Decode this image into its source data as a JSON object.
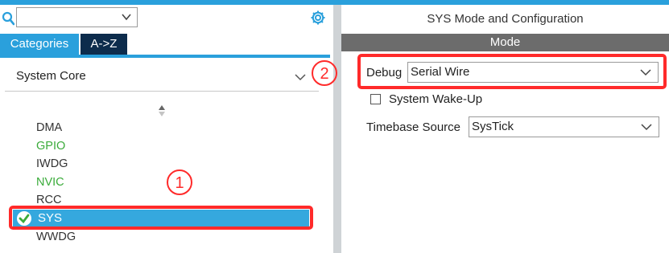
{
  "colors": {
    "accent": "#2aa0dc",
    "tab_dark": "#0d2c4c",
    "enabled_green": "#3aab3a",
    "selected_row": "#35a8de",
    "annotation_red": "#ff2a2a",
    "mode_bar": "#6c6c6c"
  },
  "left": {
    "search": {
      "value": "",
      "icon": "search-icon"
    },
    "tabs": [
      {
        "label": "Categories",
        "active": true
      },
      {
        "label": "A->Z",
        "active": false
      }
    ],
    "category": {
      "title": "System Core"
    },
    "items": [
      {
        "label": "DMA",
        "status": "normal"
      },
      {
        "label": "GPIO",
        "status": "enabled"
      },
      {
        "label": "IWDG",
        "status": "normal"
      },
      {
        "label": "NVIC",
        "status": "enabled"
      },
      {
        "label": "RCC",
        "status": "normal"
      },
      {
        "label": "SYS",
        "status": "selected-configured"
      },
      {
        "label": "WWDG",
        "status": "normal"
      }
    ],
    "annotation": "①"
  },
  "right": {
    "title": "SYS Mode and Configuration",
    "mode_header": "Mode",
    "debug": {
      "label": "Debug",
      "value": "Serial Wire"
    },
    "wakeup": {
      "label": "System Wake-Up",
      "checked": false
    },
    "timebase": {
      "label": "Timebase Source",
      "value": "SysTick"
    },
    "annotation": "②"
  }
}
